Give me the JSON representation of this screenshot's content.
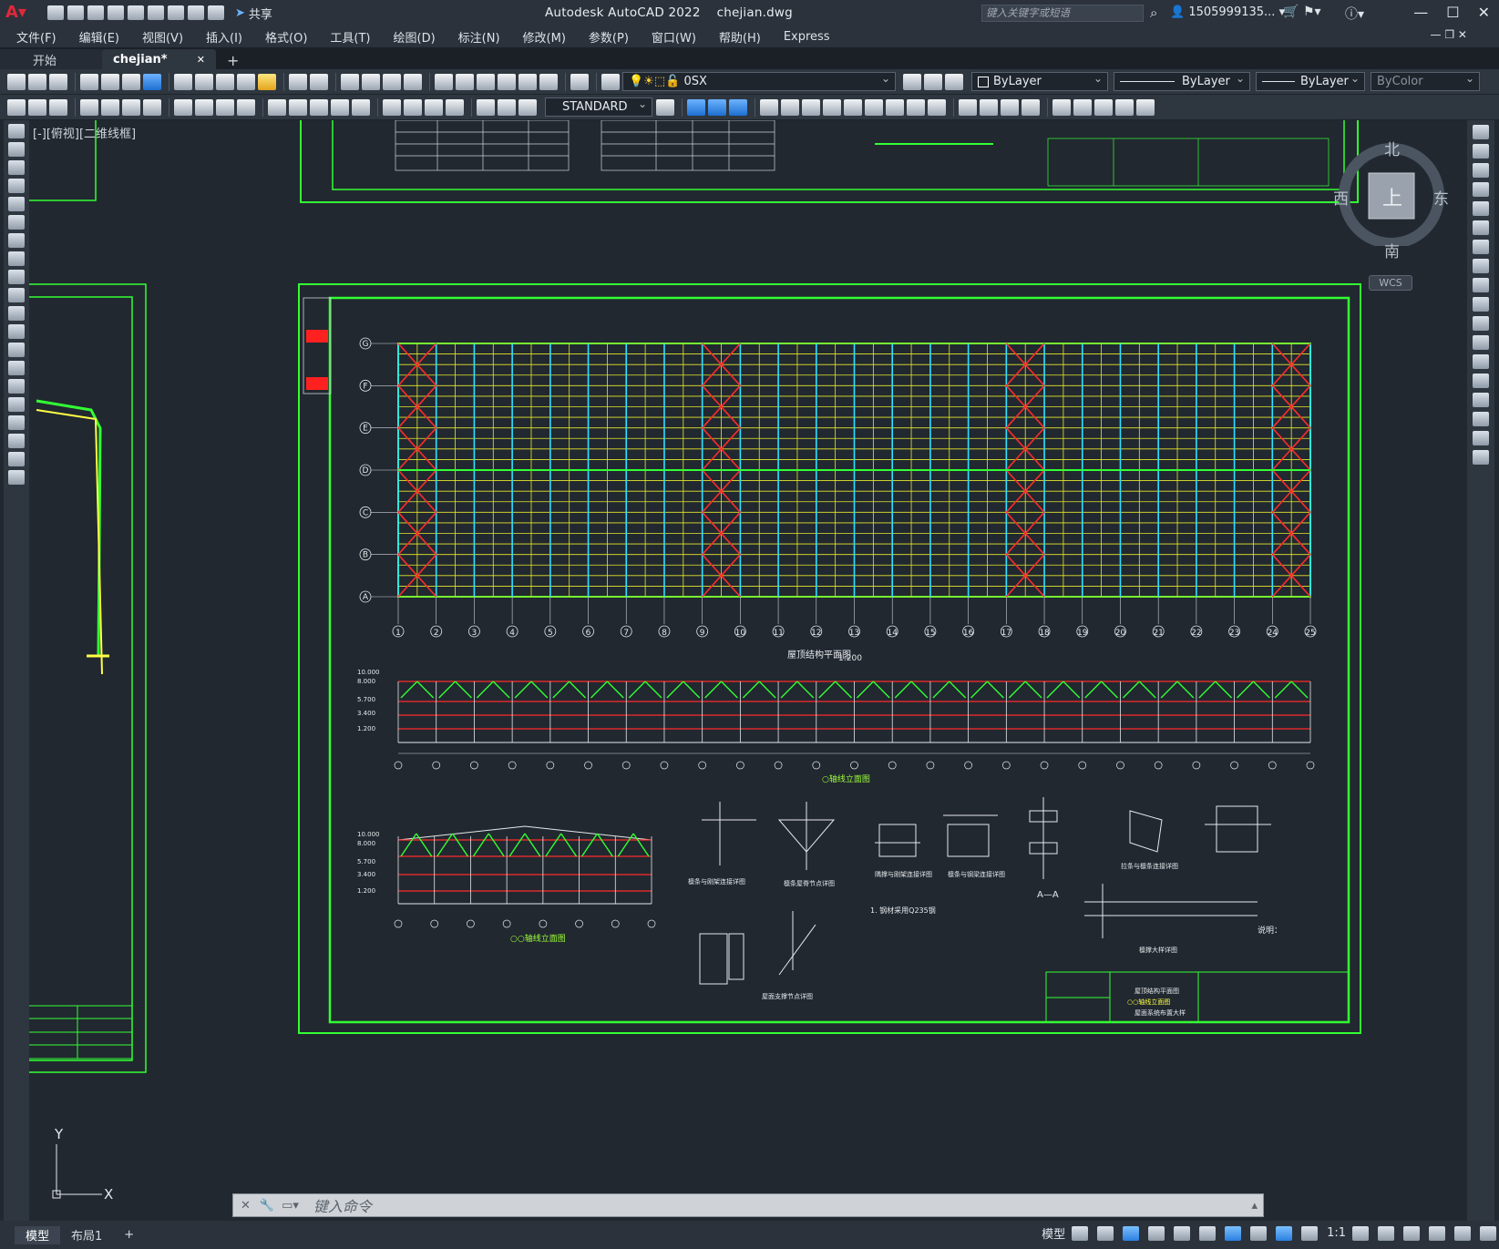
{
  "app": {
    "title": "Autodesk AutoCAD 2022",
    "filename": "chejian.dwg",
    "search_placeholder": "键入关键字或短语",
    "user": "1505999135...",
    "share": "共享"
  },
  "menu": [
    "文件(F)",
    "编辑(E)",
    "视图(V)",
    "插入(I)",
    "格式(O)",
    "工具(T)",
    "绘图(D)",
    "标注(N)",
    "修改(M)",
    "参数(P)",
    "窗口(W)",
    "帮助(H)",
    "Express"
  ],
  "tabs": {
    "start": "开始",
    "active": "chejian*",
    "close": "✕",
    "add": "+"
  },
  "toolbar": {
    "layer": "0SX",
    "color": "ByLayer",
    "linetype": "ByLayer",
    "lineweight": "ByLayer",
    "plotstyle": "ByColor",
    "textstyle": "STANDARD"
  },
  "viewport": {
    "view_label": "[-][俯视][二维线框]",
    "compass": {
      "north": "北",
      "south": "南",
      "east": "东",
      "west": "西",
      "center": "上"
    },
    "wcs": "WCS",
    "ucs_x": "X",
    "ucs_y": "Y"
  },
  "drawing": {
    "grid_rows": [
      "G",
      "F",
      "E",
      "D",
      "C",
      "B",
      "A"
    ],
    "grid_cols": [
      "1",
      "2",
      "3",
      "4",
      "5",
      "6",
      "7",
      "8",
      "9",
      "10",
      "11",
      "12",
      "13",
      "14",
      "15",
      "16",
      "17",
      "18",
      "19",
      "20",
      "21",
      "22",
      "23",
      "24",
      "25"
    ],
    "plan_title": "屋顶结构平面图",
    "plan_scale": "1:200",
    "elev1_title": "○轴线立面图",
    "elev2_title": "○○轴线立面图",
    "note_heading": "说明：",
    "elev_levels": [
      "10.000",
      "8.000",
      "5.700",
      "3.400",
      "1.200"
    ],
    "details": [
      "檩条与刚架连接详图",
      "檩条屋脊节点详图",
      "隅撑与刚架连接详图",
      "檩条与钢梁连接详图",
      "A—A",
      "拉条与檩条连接详图",
      "屋面支撑节点详图",
      "檩撑大样详图"
    ],
    "note_text": "1. 钢材采用Q235钢",
    "title_block": [
      "屋顶结构平面图",
      "○○轴线立面图",
      "屋面系统布置大样"
    ]
  },
  "command": {
    "placeholder": "键入命令"
  },
  "status": {
    "layout_tabs": [
      "模型",
      "布局1"
    ],
    "add": "+",
    "model": "模型",
    "scale": "1:1"
  }
}
